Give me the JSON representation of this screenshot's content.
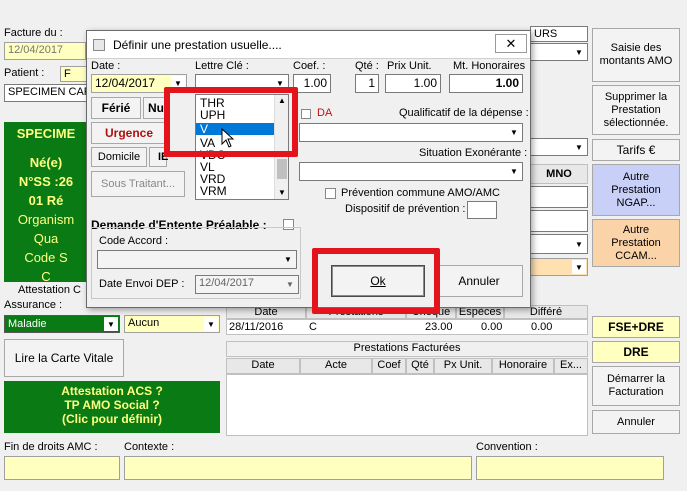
{
  "background": {
    "facture_label": "Facture du :",
    "facture_date": "12/04/2017",
    "patient_label": "Patient :",
    "patient_code": "F",
    "patient_name": "SPECIMEN CAR",
    "top_col_partial": "URS",
    "green_card": {
      "name": "SPECIME",
      "born": "Né(e)",
      "nss": "N°SS :26",
      "rank": "01 Ré",
      "org": "Organism",
      "qua": "Qua",
      "code": "Code S",
      "c": "C"
    },
    "attestation_label": "Attestation C",
    "assurance_label": "Assurance :",
    "assurance_value": "Maladie",
    "payeur_value": "Aucun",
    "read_card_button": "Lire la Carte Vitale",
    "acs_box": {
      "line1": "Attestation ACS ?",
      "line2": "TP AMO Social ?",
      "line3": "(Clic pour définir)"
    },
    "fin_droits_label": "Fin de droits AMC :",
    "contexte_label": "Contexte :",
    "convention_label": "Convention :",
    "mno_label": "MNO",
    "history_grid": {
      "headers": [
        "Date",
        "Prestations",
        "Chèque",
        "Espèces",
        "Différé"
      ],
      "row": [
        "28/11/2016",
        "C",
        "23.00",
        "0.00",
        "0.00"
      ]
    },
    "billed_grid": {
      "title": "Prestations Facturées",
      "headers": [
        "Date",
        "Acte",
        "Coef",
        "Qté",
        "Px Unit.",
        "Honoraire",
        "Ex..."
      ]
    },
    "right_buttons": {
      "saisie": "Saisie des montants AMO",
      "supprimer": "Supprimer la Prestation sélectionnée.",
      "tarifs": "Tarifs €",
      "ngap": "Autre Prestation NGAP...",
      "ccam": "Autre Prestation CCAM...",
      "fse": "FSE+DRE",
      "dre": "DRE",
      "demarrer": "Démarrer la Facturation",
      "annuler": "Annuler"
    }
  },
  "dialog": {
    "title": "Définir une prestation usuelle....",
    "date_label": "Date :",
    "date_value": "12/04/2017",
    "lettre_label": "Lettre Clé :",
    "coef_label": "Coef. :",
    "coef_value": "1.00",
    "qte_label": "Qté :",
    "qte_value": "1",
    "prix_label": "Prix Unit.",
    "prix_value": "1.00",
    "honoraires_label": "Mt. Honoraires",
    "honoraires_value": "1.00",
    "ferie_button": "Férié",
    "nuit_button": "Nu",
    "urgence_button": "Urgence",
    "domicile_button": "Domicile",
    "id_button": "IE",
    "sous_traitant_button": "Sous Traitant...",
    "da_label": "DA",
    "qualificatif_label": "Qualificatif de la dépense :",
    "situation_label": "Situation Exonérante :",
    "prevention_label": "Prévention commune AMO/AMC",
    "dispositif_label": "Dispositif de prévention :",
    "entente_label": "Demande d'Entente Préalable :",
    "code_accord_label": "Code Accord :",
    "date_envoi_label": "Date Envoi DEP :",
    "date_envoi_value": "12/04/2017",
    "ok_button": "Ok",
    "annuler_button": "Annuler",
    "lettre_list": [
      "THR",
      "UPH",
      "V",
      "VA",
      "VDC",
      "VL",
      "VRD",
      "VRM"
    ],
    "lettre_selected": "V"
  },
  "colors": {
    "green": "#0a7a14",
    "highlight": "#e3141c",
    "selection": "#0078d7",
    "yellow_field": "#ffffc0"
  }
}
